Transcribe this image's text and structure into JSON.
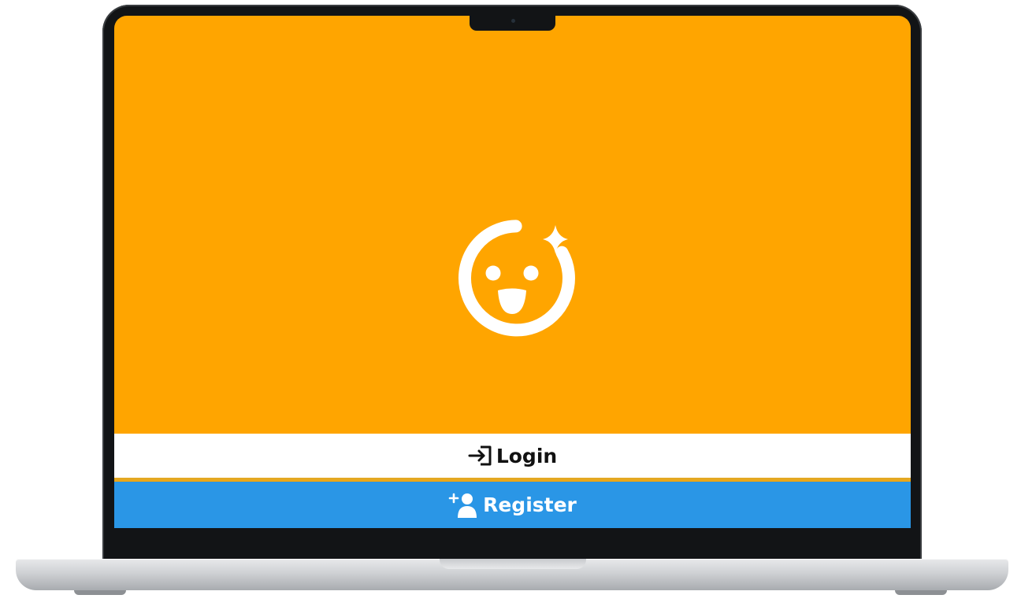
{
  "app": {
    "logo_icon": "smiley-sparkle-icon",
    "background_color": "#FFA500"
  },
  "actions": {
    "login": {
      "label": "Login",
      "icon": "login-arrow-icon",
      "background": "#FFFFFF",
      "text_color": "#111111"
    },
    "register": {
      "label": "Register",
      "icon": "add-user-icon",
      "background": "#2A96E6",
      "text_color": "#FFFFFF"
    }
  }
}
